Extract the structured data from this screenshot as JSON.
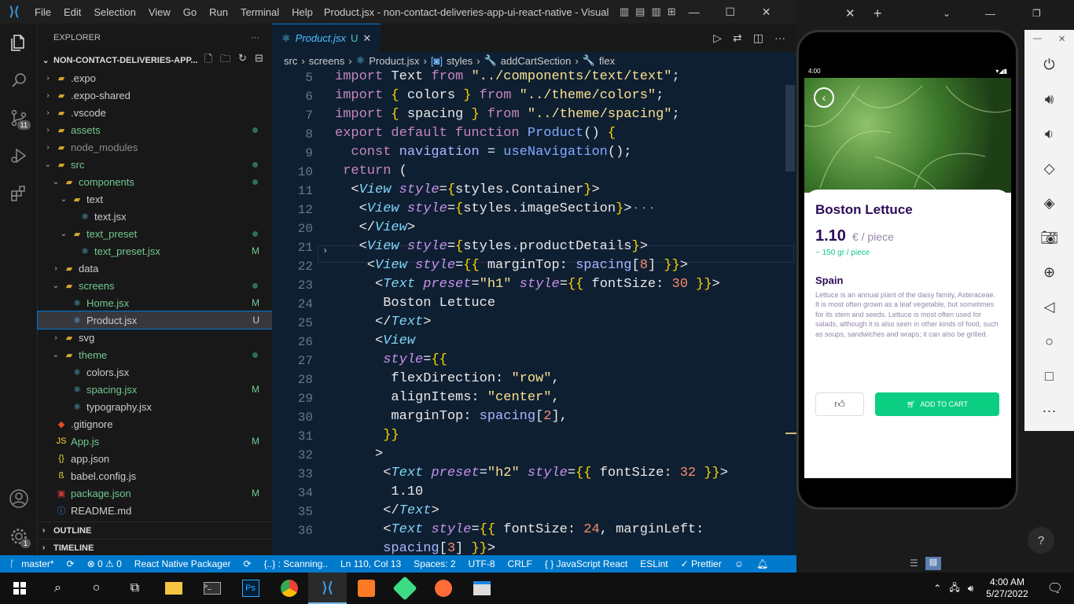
{
  "titlebar": {
    "menus": [
      "File",
      "Edit",
      "Selection",
      "View",
      "Go",
      "Run",
      "Terminal",
      "Help"
    ],
    "window_title": "Product.jsx - non-contact-deliveries-app-ui-react-native - Visual Stu...",
    "controls": [
      "—",
      "☐",
      "✕"
    ]
  },
  "activity": {
    "source_control_badge": "11",
    "settings_badge": "1"
  },
  "explorer": {
    "header": "EXPLORER",
    "project": "NON-CONTACT-DELIVERIES-APP...",
    "items": [
      {
        "label": ".expo",
        "depth": 1,
        "type": "folder",
        "color": "#cccccc",
        "status": ""
      },
      {
        "label": ".expo-shared",
        "depth": 1,
        "type": "folder",
        "color": "#cccccc",
        "status": ""
      },
      {
        "label": ".vscode",
        "depth": 1,
        "type": "folder",
        "color": "#cccccc",
        "status": ""
      },
      {
        "label": "assets",
        "depth": 1,
        "type": "folder",
        "color": "#73c991",
        "status": "dot"
      },
      {
        "label": "node_modules",
        "depth": 1,
        "type": "folder",
        "color": "#8c8c8c",
        "status": ""
      },
      {
        "label": "src",
        "depth": 1,
        "type": "folder-open",
        "color": "#73c991",
        "status": "dot"
      },
      {
        "label": "components",
        "depth": 2,
        "type": "folder-open",
        "color": "#73c991",
        "status": "dot"
      },
      {
        "label": "text",
        "depth": 3,
        "type": "folder-open",
        "color": "#cccccc",
        "status": ""
      },
      {
        "label": "text.jsx",
        "depth": 4,
        "type": "react",
        "color": "#cccccc",
        "status": ""
      },
      {
        "label": "text_preset",
        "depth": 3,
        "type": "folder-open",
        "color": "#73c991",
        "status": "dot"
      },
      {
        "label": "text_preset.jsx",
        "depth": 4,
        "type": "react",
        "color": "#73c991",
        "status": "M"
      },
      {
        "label": "data",
        "depth": 2,
        "type": "folder",
        "color": "#cccccc",
        "status": ""
      },
      {
        "label": "screens",
        "depth": 2,
        "type": "folder-open",
        "color": "#73c991",
        "status": "dot"
      },
      {
        "label": "Home.jsx",
        "depth": 3,
        "type": "react",
        "color": "#73c991",
        "status": "M"
      },
      {
        "label": "Product.jsx",
        "depth": 3,
        "type": "react",
        "color": "#cccccc",
        "status": "U",
        "selected": true
      },
      {
        "label": "svg",
        "depth": 2,
        "type": "folder",
        "color": "#cccccc",
        "status": ""
      },
      {
        "label": "theme",
        "depth": 2,
        "type": "folder-open",
        "color": "#73c991",
        "status": "dot"
      },
      {
        "label": "colors.jsx",
        "depth": 3,
        "type": "react",
        "color": "#cccccc",
        "status": ""
      },
      {
        "label": "spacing.jsx",
        "depth": 3,
        "type": "react",
        "color": "#73c991",
        "status": "M"
      },
      {
        "label": "typography.jsx",
        "depth": 3,
        "type": "react",
        "color": "#cccccc",
        "status": ""
      },
      {
        "label": ".gitignore",
        "depth": 1,
        "type": "git",
        "color": "#cccccc",
        "status": ""
      },
      {
        "label": "App.js",
        "depth": 1,
        "type": "js",
        "color": "#73c991",
        "status": "M"
      },
      {
        "label": "app.json",
        "depth": 1,
        "type": "json",
        "color": "#cccccc",
        "status": ""
      },
      {
        "label": "babel.config.js",
        "depth": 1,
        "type": "babel",
        "color": "#cccccc",
        "status": ""
      },
      {
        "label": "package.json",
        "depth": 1,
        "type": "npm",
        "color": "#73c991",
        "status": "M"
      },
      {
        "label": "README.md",
        "depth": 1,
        "type": "info",
        "color": "#cccccc",
        "status": ""
      }
    ],
    "outline": "OUTLINE",
    "timeline": "TIMELINE"
  },
  "tab": {
    "label": "Product.jsx",
    "status": "U"
  },
  "breadcrumb": [
    "src",
    "screens",
    "Product.jsx",
    "styles",
    "addCartSection",
    "flex"
  ],
  "code_lines": [
    {
      "n": "5",
      "h": "<span class=\"k\">import</span> Text <span class=\"k\">from</span> <span class=\"s\">\"../components/text/text\"</span>;"
    },
    {
      "n": "6",
      "h": "<span class=\"k\">import</span> <span class=\"br\">{</span> colors <span class=\"br\">}</span> <span class=\"k\">from</span> <span class=\"s\">\"../theme/colors\"</span>;"
    },
    {
      "n": "7",
      "h": "<span class=\"k\">import</span> <span class=\"br\">{</span> spacing <span class=\"br\">}</span> <span class=\"k\">from</span> <span class=\"s\">\"../theme/spacing\"</span>;"
    },
    {
      "n": "8",
      "h": "<span class=\"k\">export default function</span> <span class=\"p\">Product</span>() <span class=\"br\">{</span>"
    },
    {
      "n": "9",
      "h": "  <span class=\"k\">const</span> <span class=\"v\">navigation</span> = <span class=\"p\">useNavigation</span>();"
    },
    {
      "n": "10",
      "h": " <span class=\"k\">return</span> ("
    },
    {
      "n": "11",
      "h": "  &lt;<span class=\"t\">View</span> <span class=\"a\">style</span>=<span class=\"br\">{</span>styles.Container<span class=\"br\">}</span>&gt;"
    },
    {
      "n": "12",
      "h": "   &lt;<span class=\"t\">View</span> <span class=\"a\">style</span>=<span class=\"br\">{</span>styles.imageSection<span class=\"br\">}</span>&gt;<span style=\"color:#888\">···</span>"
    },
    {
      "n": "20",
      "h": "   &lt;/<span class=\"t\">View</span>&gt;"
    },
    {
      "n": "21",
      "h": "   &lt;<span class=\"t\">View</span> <span class=\"a\">style</span>=<span class=\"br\">{</span>styles.productDetails<span class=\"br\">}</span>&gt;"
    },
    {
      "n": "22",
      "h": "    &lt;<span class=\"t\">View</span> <span class=\"a\">style</span>=<span class=\"br\">{{</span> marginTop: <span class=\"v\">spacing</span>[<span class=\"n\">8</span>] <span class=\"br\">}}</span>&gt;"
    },
    {
      "n": "23",
      "h": "     &lt;<span class=\"t\">Text</span> <span class=\"a\">preset</span>=<span class=\"s\">\"h1\"</span> <span class=\"a\">style</span>=<span class=\"br\">{{</span> fontSize: <span class=\"n\">30</span> <span class=\"br\">}}</span>&gt;"
    },
    {
      "n": "24",
      "h": "      Boston Lettuce"
    },
    {
      "n": "25",
      "h": "     &lt;/<span class=\"t\">Text</span>&gt;"
    },
    {
      "n": "26",
      "h": "     &lt;<span class=\"t\">View</span>"
    },
    {
      "n": "27",
      "h": "      <span class=\"a\">style</span>=<span class=\"br\">{{</span>"
    },
    {
      "n": "28",
      "h": "       flexDirection: <span class=\"s\">\"row\"</span>,"
    },
    {
      "n": "29",
      "h": "       alignItems: <span class=\"s\">\"center\"</span>,"
    },
    {
      "n": "30",
      "h": "       marginTop: <span class=\"v\">spacing</span>[<span class=\"n\">2</span>],"
    },
    {
      "n": "31",
      "h": "      <span class=\"br\">}}</span>"
    },
    {
      "n": "32",
      "h": "     &gt;"
    },
    {
      "n": "33",
      "h": "      &lt;<span class=\"t\">Text</span> <span class=\"a\">preset</span>=<span class=\"s\">\"h2\"</span> <span class=\"a\">style</span>=<span class=\"br\">{{</span> fontSize: <span class=\"n\">32</span> <span class=\"br\">}}</span>&gt;"
    },
    {
      "n": "34",
      "h": "       1.10"
    },
    {
      "n": "35",
      "h": "      &lt;/<span class=\"t\">Text</span>&gt;"
    },
    {
      "n": "36",
      "h": "      &lt;<span class=\"t\">Text</span> <span class=\"a\">style</span>=<span class=\"br\">{{</span> fontSize: <span class=\"n\">24</span>, marginLeft:"
    },
    {
      "n": "",
      "h": "      <span class=\"v\">spacing</span>[<span class=\"n\">3</span>] <span class=\"br\">}}</span>&gt;"
    }
  ],
  "app": {
    "status_time": "4:00",
    "product_name": "Boston Lettuce",
    "price": "1.10",
    "unit": "€ / piece",
    "weight": "~ 150 gr / piece",
    "origin": "Spain",
    "description": "Lettuce is an annual plant of the daisy family, Asteraceae. It is most often grown as a leaf vegetable, but sometimes for its stem and seeds. Lettuce is most often used for salads, although it is also seen in other kinds of food, such as soups, sandwiches and wraps; it can also be grilled.",
    "add_to_cart": "ADD TO CART",
    "accent": "#0bce83",
    "title_color": "#2d0c57"
  },
  "statusbar": {
    "branch": "master*",
    "errors": "⊗ 0 ⚠ 0",
    "packager": "React Native Packager",
    "scanning": "{..} : Scanning..",
    "position": "Ln 110, Col 13",
    "spaces": "Spaces: 2",
    "encoding": "UTF-8",
    "eol": "CRLF",
    "language": "{ } JavaScript React",
    "eslint": "ESLint",
    "prettier": "✓ Prettier"
  },
  "taskbar": {
    "time": "4:00 AM",
    "date": "5/27/2022"
  }
}
